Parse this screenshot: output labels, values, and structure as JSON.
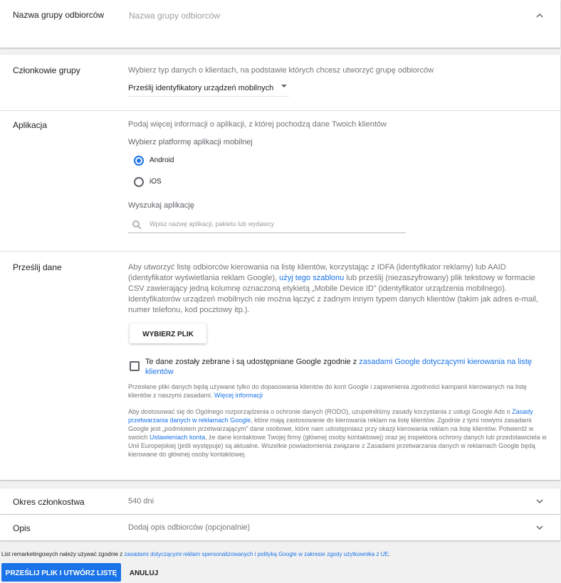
{
  "name_section": {
    "label": "Nazwa grupy odbiorców",
    "placeholder": "Nazwa grupy odbiorców"
  },
  "members_section": {
    "label": "Członkowie grupy",
    "description": "Wybierz typ danych o klientach, na podstawie których chcesz utworzyć grupę odbiorców",
    "dropdown_value": "Prześlij identyfikatory urządzeń mobilnych"
  },
  "app_section": {
    "label": "Aplikacja",
    "description": "Podaj więcej informacji o aplikacji, z której pochodzą dane Twoich klientów",
    "platform_label": "Wybierz platformę aplikacji mobilnej",
    "options": [
      "Android",
      "iOS"
    ],
    "selected_option": "Android",
    "search_label": "Wyszukaj aplikację",
    "search_placeholder": "Wpisz nazwę aplikacji, pakietu lub wydawcy"
  },
  "upload_section": {
    "label": "Prześlij dane",
    "para_1a": "Aby utworzyć listę odbiorców kierowania na listę klientów, korzystając z IDFA (identyfikator reklamy) lub AAID (identyfikator wyświetlania reklam Google), ",
    "para_1_link": "użyj tego szablonu",
    "para_1b": " lub prześlij (niezaszyfrowany) plik tekstowy w formacie CSV zawierający jedną kolumnę oznaczoną etykietą „Mobile Device ID” (identyfikator urządzenia mobilnego). Identyfikatorów urządzeń mobilnych nie można łączyć z żadnym innym typem danych klientów (takim jak adres e-mail, numer telefonu, kod pocztowy itp.).",
    "choose_file_button": "WYBIERZ PLIK",
    "consent_text": "Te dane zostały zebrane i są udostępniane Google zgodnie z ",
    "consent_link": "zasadami Google dotyczącymi kierowania na listę klientów",
    "note_1": "Przesłane pliki danych będą używane tylko do dopasowania klientów do kont Google i zapewnienia zgodności kampanii kierowanych na listę klientów z naszymi zasadami. ",
    "note_1_link": "Więcej informacji",
    "note_2a": "Aby dostosować się do Ogólnego rozporządzenia o ochronie danych (RODO), uzupełniliśmy zasady korzystania z usługi Google Ads o ",
    "note_2_link_1": "Zasady przetwarzania danych w reklamach Google",
    "note_2b": ", które mają zastosowanie do kierowania reklam na listę klientów. Zgodnie z tymi nowymi zasadami Google jest „podmiotem przetwarzającym” dane osobowe, które nam udostępniasz przy okazji kierowania reklam na listę klientów. Potwierdź w swoich ",
    "note_2_link_2": "Ustawieniach konta",
    "note_2c": ", że dane kontaktowe Twojej firmy (głównej osoby kontaktowej) oraz jej inspektora ochrony danych lub przedstawiciela w Unii Europejskiej (jeśli występuje) są aktualne. Wszelkie powiadomienia związane z Zasadami przetwarzania danych w reklamach Google będą kierowane do głównej osoby kontaktowej."
  },
  "membership_section": {
    "label": "Okres członkostwa",
    "value": "540 dni"
  },
  "description_section": {
    "label": "Opis",
    "value": "Dodaj opis odbiorców (opcjonalnie)"
  },
  "footer": {
    "text_a": "List remarketingowych należy używać zgodnie z ",
    "link": "zasadami dotyczącymi reklam spersonalizowanych i polityką Google w zakresie zgody użytkownika z UE",
    "text_b": ".",
    "primary_button": "PRZEŚLIJ PLIK I UTWÓRZ LISTĘ",
    "cancel_button": "ANULUJ"
  },
  "colors": {
    "accent": "#1a73e8",
    "button_bg": "#1a73e8",
    "muted": "#757575"
  }
}
